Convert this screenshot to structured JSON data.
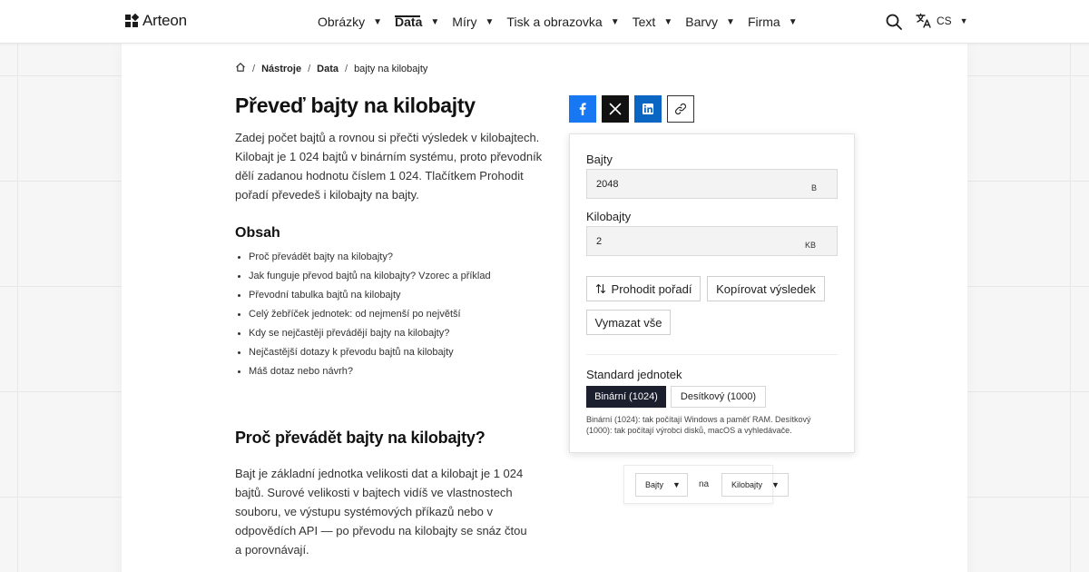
{
  "header": {
    "logo_text": "Arteon",
    "nav": [
      {
        "label": "Obrázky",
        "active": false
      },
      {
        "label": "Data",
        "active": true
      },
      {
        "label": "Míry",
        "active": false
      },
      {
        "label": "Tisk a obrazovka",
        "active": false
      },
      {
        "label": "Text",
        "active": false
      },
      {
        "label": "Barvy",
        "active": false
      },
      {
        "label": "Firma",
        "active": false
      }
    ],
    "caret": "▼",
    "lang": "CS"
  },
  "breadcrumb": {
    "home_icon": "home-icon",
    "sep": "/",
    "items": [
      "Nástroje",
      "Data",
      "bajty na kilobajty"
    ]
  },
  "article": {
    "title": "Převeď bajty na kilobajty",
    "intro": "Zadej počet bajtů a rovnou si přečti výsledek v kilobajtech. Kilobajt je 1 024 bajtů v binárním systému, proto převodník dělí zadanou hodnotu číslem 1 024. Tlačítkem Prohodit pořadí převedeš i kilobajty na bajty.",
    "toc_title": "Obsah",
    "toc": [
      "Proč převádět bajty na kilobajty?",
      "Jak funguje převod bajtů na kilobajty? Vzorec a příklad",
      "Převodní tabulka bajtů na kilobajty",
      "Celý žebříček jednotek: od nejmenší po největší",
      "Kdy se nejčastěji převádějí bajty na kilobajty?",
      "Nejčastější dotazy k převodu bajtů na kilobajty",
      "Máš dotaz nebo návrh?"
    ],
    "section_title": "Proč převádět bajty na kilobajty?",
    "section_body": "Bajt je základní jednotka velikosti dat a kilobajt je 1 024 bajtů. Surové velikosti v bajtech vidíš ve vlastnostech souboru, ve výstupu systémových příkazů nebo v odpovědích API — po převodu na kilobajty se snáz čtou a porovnávají."
  },
  "share": {
    "icons": [
      "facebook-icon",
      "x-icon",
      "linkedin-icon",
      "link-icon"
    ],
    "colors": {
      "facebook": "#1877f2",
      "x": "#111111",
      "linkedin": "#0a66c2"
    }
  },
  "converter": {
    "bytes_label": "Bajty",
    "bytes_value": "2048",
    "bytes_unit": "B",
    "kb_label": "Kilobajty",
    "kb_value": "2",
    "kb_unit": "KB",
    "swap_label": "Prohodit pořadí",
    "copy_label": "Kopírovat výsledek",
    "clear_label": "Vymazat vše",
    "standard_label": "Standard jednotek",
    "binary_label": "Binární (1024)",
    "decimal_label": "Desítkový (1000)",
    "standard_note": "Binární (1024): tak počítají Windows a paměť RAM. Desítkový (1000): tak počítají výrobci disků, macOS a vyhledávače.",
    "active_color": "#1c1f2e"
  },
  "selector": {
    "from": "Bajty",
    "na": "na",
    "to": "Kilobajty"
  }
}
